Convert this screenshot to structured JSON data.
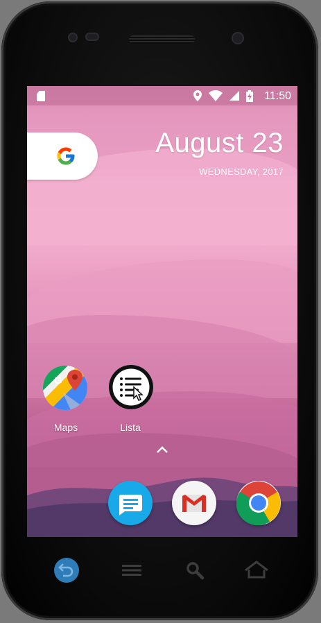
{
  "status_bar": {
    "time": "11:50",
    "icons": [
      "sd-card-icon",
      "location-icon",
      "wifi-icon",
      "signal-icon",
      "battery-charging-icon"
    ]
  },
  "widgets": {
    "search_pill_icon": "google-g-icon",
    "date": "August 23",
    "weekday_year": "WEDNESDAY, 2017"
  },
  "home_apps": [
    {
      "label": "Maps",
      "icon": "google-maps-icon"
    },
    {
      "label": "Lista",
      "icon": "list-app-icon"
    }
  ],
  "dock": [
    {
      "icon": "messages-icon"
    },
    {
      "icon": "gmail-icon"
    },
    {
      "icon": "chrome-icon"
    }
  ],
  "nav_bar": [
    {
      "icon": "back-icon"
    },
    {
      "icon": "menu-icon"
    },
    {
      "icon": "search-icon"
    },
    {
      "icon": "home-icon"
    }
  ],
  "colors": {
    "wallpaper_top": "#d87fa8",
    "wallpaper_mid": "#f2aecd",
    "wallpaper_bottom": "#b25a8c",
    "hills": "#523968",
    "messages_blue": "#17a9e8",
    "gmail_red": "#d93025",
    "back_button_blue": "#2e7db8"
  }
}
